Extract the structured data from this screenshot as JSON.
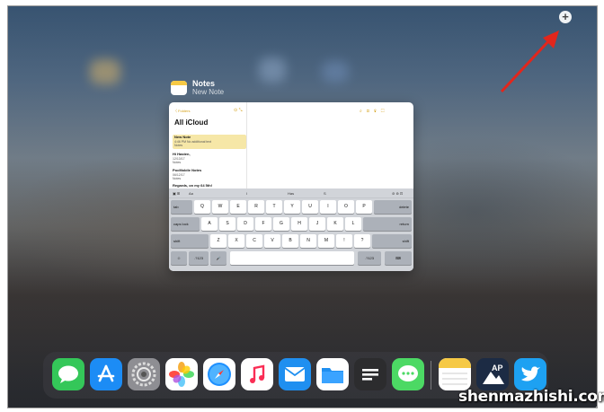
{
  "app_switcher": {
    "add_button": "+",
    "app_name": "Notes",
    "window_name": "New Note"
  },
  "notes": {
    "back": "〈 Folders",
    "list_title": "All iCloud",
    "items": [
      {
        "title": "New Note",
        "meta": "4:46 PM  No additional text",
        "folder": "Notes"
      },
      {
        "title": "Hi Hasten,",
        "meta": "12/13/17",
        "folder": "Notes"
      },
      {
        "title": "PocMobile Notes",
        "meta": "06/12/17",
        "folder": "Notes"
      },
      {
        "title": "Regards, on my 64 5th!",
        "meta": "",
        "folder": ""
      }
    ]
  },
  "keyboard": {
    "suggestions": [
      "I",
      "Has",
      "S"
    ],
    "format_label": "Aa",
    "row1": [
      "tab",
      "Q",
      "W",
      "E",
      "R",
      "T",
      "Y",
      "U",
      "I",
      "O",
      "P",
      "delete"
    ],
    "row2": [
      "caps lock",
      "A",
      "S",
      "D",
      "F",
      "G",
      "H",
      "J",
      "K",
      "L",
      "return"
    ],
    "row3": [
      "shift",
      "Z",
      "X",
      "C",
      "V",
      "B",
      "N",
      "M",
      "!",
      "?",
      "shift"
    ],
    "row4": [
      "☺",
      ".?123",
      "🎤",
      "",
      ".?123",
      "⌨"
    ]
  },
  "dock": {
    "apps": [
      "Messages",
      "App Store",
      "Settings",
      "Photos",
      "Safari",
      "Music",
      "Mail",
      "Files",
      "Notes Minimal",
      "Messages Green",
      "Notes",
      "Apollo",
      "Twitter"
    ]
  },
  "watermark": "shenmazhishi.com"
}
